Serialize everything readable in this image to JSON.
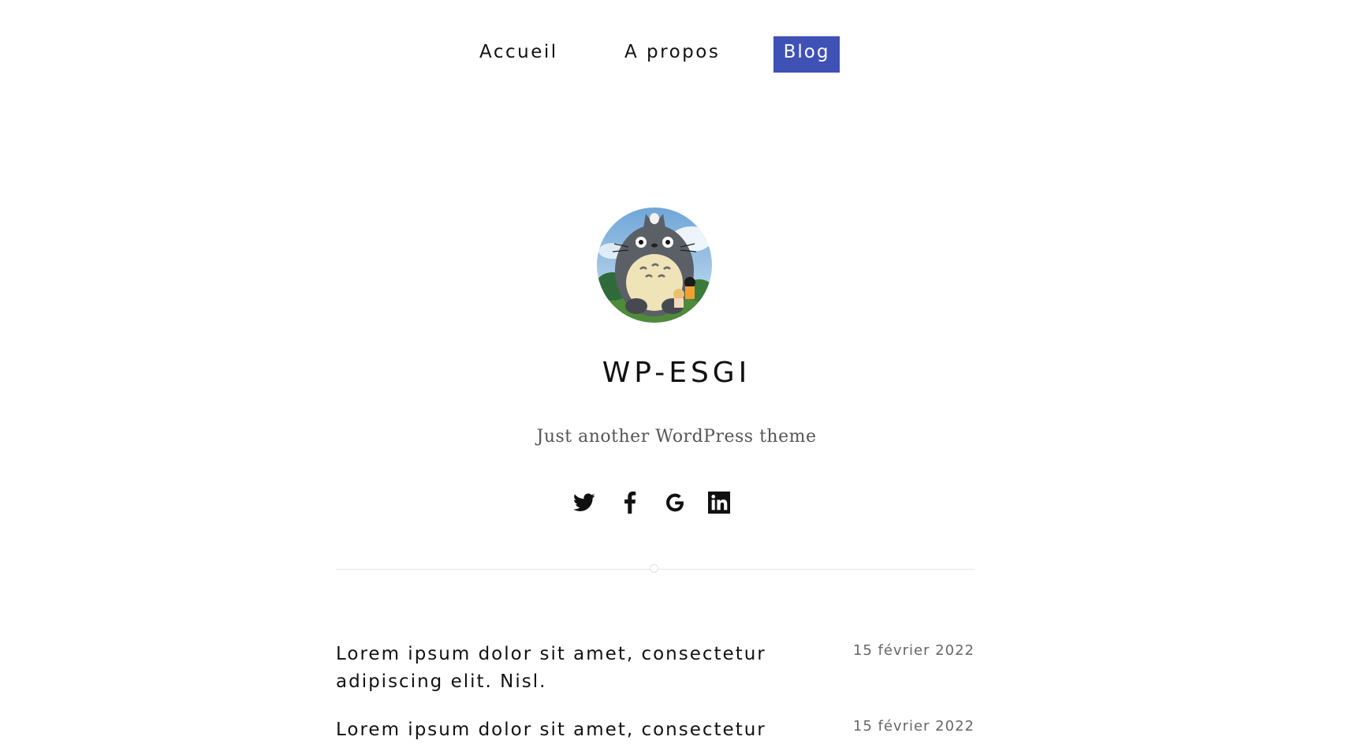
{
  "nav": {
    "items": [
      {
        "label": "Accueil"
      },
      {
        "label": "A propos"
      },
      {
        "label": "Blog"
      }
    ],
    "active_color": "#3f51b5"
  },
  "site": {
    "title": "WP-ESGI",
    "tagline": "Just another WordPress theme"
  },
  "social": {
    "icons": [
      "twitter-icon",
      "facebook-icon",
      "google-icon",
      "linkedin-icon"
    ]
  },
  "posts": [
    {
      "title": "Lorem ipsum dolor sit amet, consectetur adipiscing elit. Nisl.",
      "date": "15 février 2022"
    },
    {
      "title": "Lorem ipsum dolor sit amet, consectetur",
      "date": "15 février 2022"
    }
  ]
}
